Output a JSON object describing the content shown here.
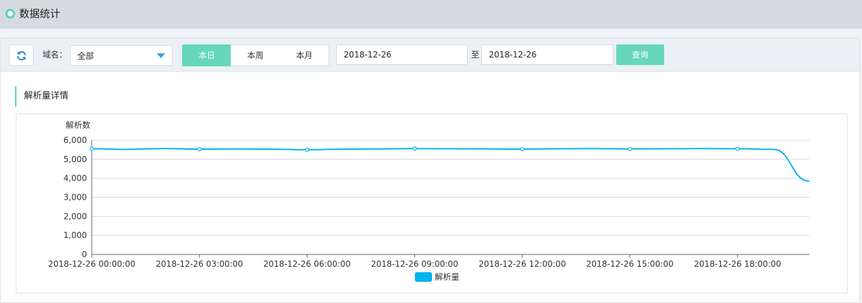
{
  "page": {
    "title": "数据统计",
    "accent_color": "#5ed2b6"
  },
  "toolbar": {
    "refresh_icon": "refresh-icon",
    "domain_label": "域名：",
    "domain_select": {
      "value": "全部"
    },
    "range_tabs": [
      {
        "label": "本日",
        "active": true
      },
      {
        "label": "本周",
        "active": false
      },
      {
        "label": "本月",
        "active": false
      }
    ],
    "date_start": "2018-12-26",
    "date_separator": "至",
    "date_end": "2018-12-26",
    "query_label": "查询"
  },
  "section": {
    "title": "解析量详情"
  },
  "chart_data": {
    "type": "line",
    "ylabel": "解析数",
    "xlabel": "",
    "ylim": [
      0,
      6000
    ],
    "y_ticks": [
      "0",
      "1,000",
      "2,000",
      "3,000",
      "4,000",
      "5,000",
      "6,000"
    ],
    "x_tick_labels": [
      "2018-12-26 00:00:00",
      "2018-12-26 03:00:00",
      "2018-12-26 06:00:00",
      "2018-12-26 09:00:00",
      "2018-12-26 12:00:00",
      "2018-12-26 15:00:00",
      "2018-12-26 18:00:00"
    ],
    "x_hours": [
      0,
      1,
      2,
      3,
      4,
      5,
      6,
      7,
      8,
      9,
      10,
      11,
      12,
      13,
      14,
      15,
      16,
      17,
      18,
      19,
      20
    ],
    "x_max_hours": 20,
    "series": [
      {
        "name": "解析量",
        "color": "#00b4ef",
        "values": [
          5550,
          5520,
          5560,
          5530,
          5540,
          5530,
          5500,
          5530,
          5540,
          5560,
          5550,
          5540,
          5530,
          5550,
          5560,
          5540,
          5550,
          5560,
          5550,
          5520,
          3850
        ]
      }
    ],
    "grid": true,
    "legend_position": "bottom-center"
  }
}
